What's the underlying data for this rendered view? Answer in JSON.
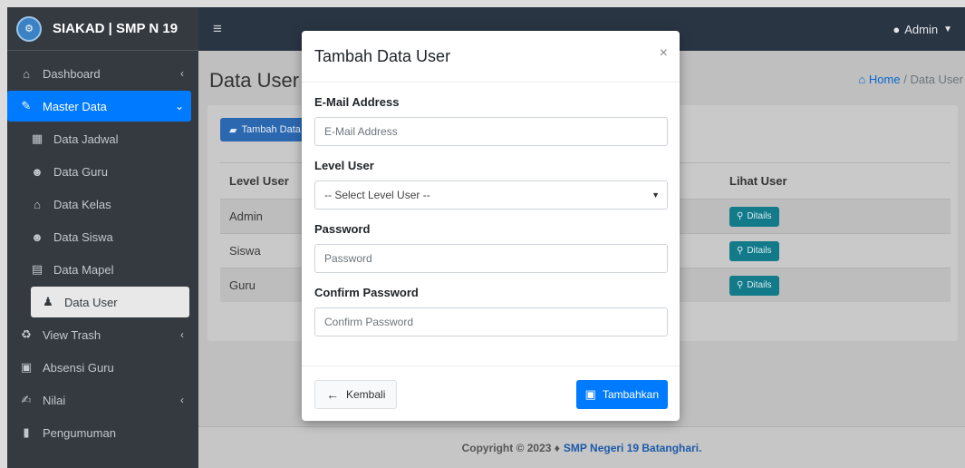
{
  "brand": {
    "name": "SIAKAD | SMP N 19",
    "logo_icon": "school-logo"
  },
  "topbar": {
    "menu_icon": "hamburger-icon",
    "user_label": "Admin",
    "user_icon": "user-circle-icon"
  },
  "sidebar": {
    "items": [
      {
        "label": "Dashboard",
        "icon": "home-icon"
      },
      {
        "label": "Master Data",
        "icon": "edit-icon"
      },
      {
        "label": "Data Jadwal",
        "icon": "calendar-icon"
      },
      {
        "label": "Data Guru",
        "icon": "users-icon"
      },
      {
        "label": "Data Kelas",
        "icon": "home-icon"
      },
      {
        "label": "Data Siswa",
        "icon": "users-icon"
      },
      {
        "label": "Data Mapel",
        "icon": "book-icon"
      },
      {
        "label": "Data User",
        "icon": "user-plus-icon"
      },
      {
        "label": "View Trash",
        "icon": "recycle-icon"
      },
      {
        "label": "Absensi Guru",
        "icon": "calendar-check-icon"
      },
      {
        "label": "Nilai",
        "icon": "signature-icon"
      },
      {
        "label": "Pengumuman",
        "icon": "clipboard-icon"
      }
    ]
  },
  "page": {
    "title": "Data User",
    "breadcrumb_home": "Home",
    "breadcrumb_sep": "/",
    "breadcrumb_current": "Data User",
    "add_button": "Tambah Data"
  },
  "table": {
    "headers": [
      "Level User",
      "Lihat User"
    ],
    "rows": [
      {
        "level": "Admin",
        "action": "Ditails"
      },
      {
        "level": "Siswa",
        "action": "Ditails"
      },
      {
        "level": "Guru",
        "action": "Ditails"
      }
    ]
  },
  "footer": {
    "prefix": "Copyright © 2023 ♦",
    "org": "SMP Negeri 19 Batanghari."
  },
  "modal": {
    "title": "Tambah Data User",
    "close": "×",
    "email_label": "E-Mail Address",
    "email_placeholder": "E-Mail Address",
    "level_label": "Level User",
    "level_selected": "-- Select Level User --",
    "password_label": "Password",
    "password_placeholder": "Password",
    "confirm_label": "Confirm Password",
    "confirm_placeholder": "Confirm Password",
    "back_button": "Kembali",
    "submit_button": "Tambahkan"
  },
  "colors": {
    "primary": "#007bff",
    "sidebar_bg": "#343a40",
    "topbar_bg": "#2a3544",
    "info": "#137a8a"
  }
}
